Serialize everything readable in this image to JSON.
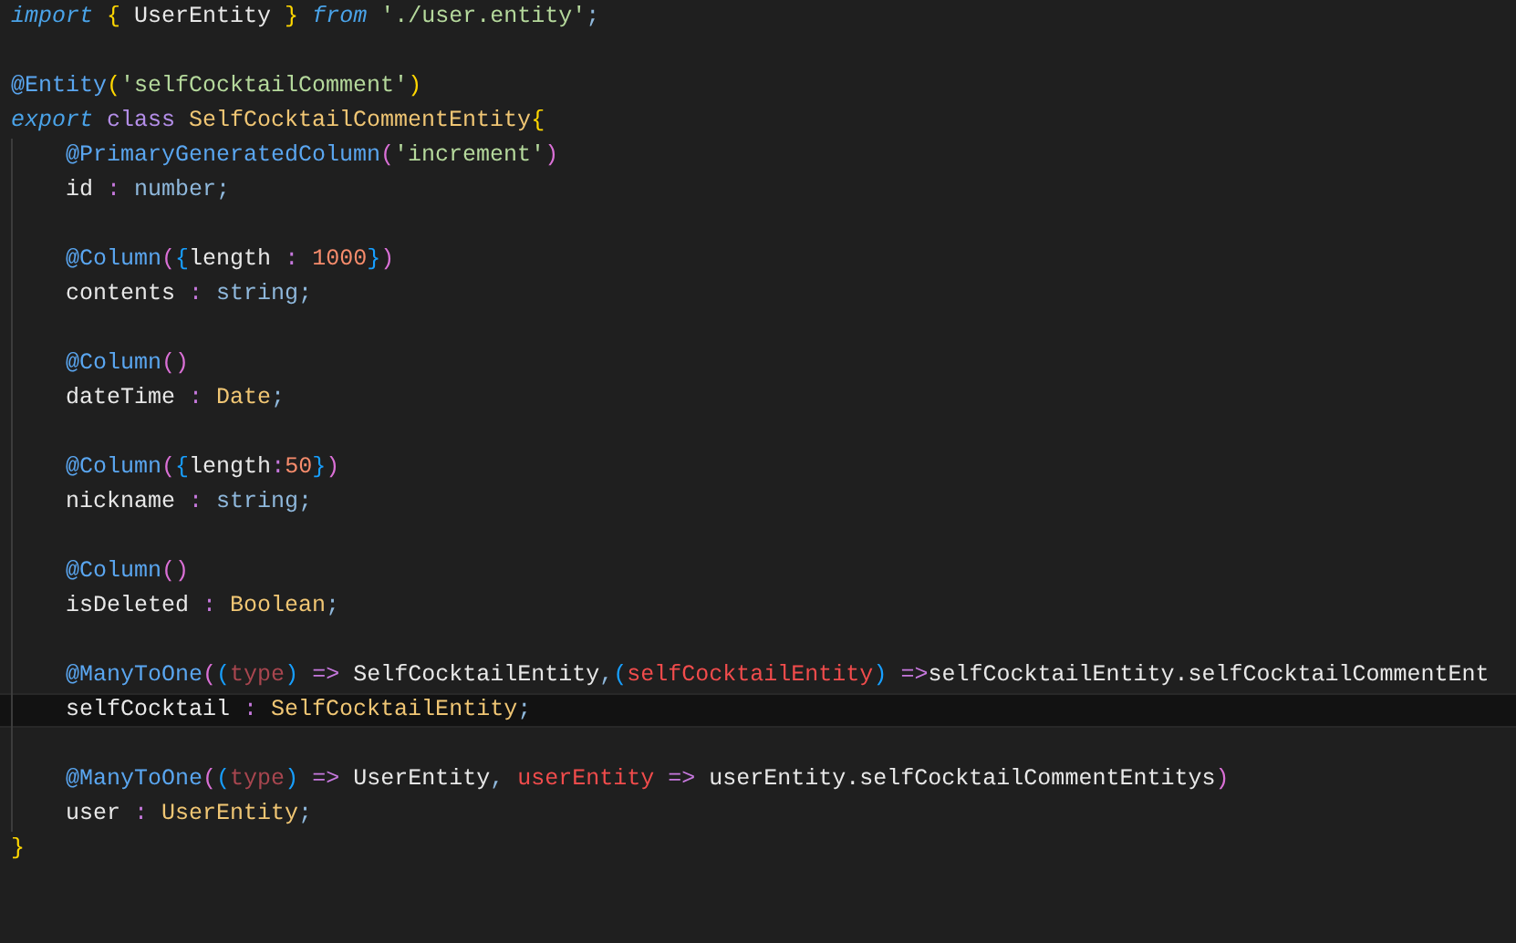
{
  "editor": {
    "lines": [
      {
        "indented": false,
        "tokens": [
          {
            "kind": "kw",
            "text": "import "
          },
          {
            "kind": "brace",
            "text": "{"
          },
          {
            "kind": "plain",
            "text": " UserEntity "
          },
          {
            "kind": "brace",
            "text": "}"
          },
          {
            "kind": "kw",
            "text": " from "
          },
          {
            "kind": "str",
            "text": "'./user.entity'"
          },
          {
            "kind": "punc",
            "text": ";"
          }
        ]
      },
      {
        "indented": false
      },
      {
        "indented": false,
        "tokens": [
          {
            "kind": "dec",
            "text": "@Entity"
          },
          {
            "kind": "brace",
            "text": "("
          },
          {
            "kind": "str",
            "text": "'selfCocktailComment'"
          },
          {
            "kind": "brace",
            "text": ")"
          }
        ]
      },
      {
        "indented": false,
        "tokens": [
          {
            "kind": "kw",
            "text": "export "
          },
          {
            "kind": "storage",
            "text": "class "
          },
          {
            "kind": "type",
            "text": "SelfCocktailCommentEntity"
          },
          {
            "kind": "brace",
            "text": "{"
          }
        ]
      },
      {
        "indented": true,
        "tokens": [
          {
            "kind": "dec",
            "text": "@PrimaryGeneratedColumn"
          },
          {
            "kind": "paren",
            "text": "("
          },
          {
            "kind": "str",
            "text": "'increment'"
          },
          {
            "kind": "paren",
            "text": ")"
          }
        ]
      },
      {
        "indented": true,
        "tokens": [
          {
            "kind": "plain",
            "text": "id "
          },
          {
            "kind": "op",
            "text": ": "
          },
          {
            "kind": "prim",
            "text": "number"
          },
          {
            "kind": "punc",
            "text": ";"
          }
        ]
      },
      {
        "indented": true
      },
      {
        "indented": true,
        "tokens": [
          {
            "kind": "dec",
            "text": "@Column"
          },
          {
            "kind": "paren",
            "text": "("
          },
          {
            "kind": "bracket",
            "text": "{"
          },
          {
            "kind": "plain",
            "text": "length "
          },
          {
            "kind": "op",
            "text": ": "
          },
          {
            "kind": "num",
            "text": "1000"
          },
          {
            "kind": "bracket",
            "text": "}"
          },
          {
            "kind": "paren",
            "text": ")"
          }
        ]
      },
      {
        "indented": true,
        "tokens": [
          {
            "kind": "plain",
            "text": "contents "
          },
          {
            "kind": "op",
            "text": ": "
          },
          {
            "kind": "prim",
            "text": "string"
          },
          {
            "kind": "punc",
            "text": ";"
          }
        ]
      },
      {
        "indented": true
      },
      {
        "indented": true,
        "tokens": [
          {
            "kind": "dec",
            "text": "@Column"
          },
          {
            "kind": "paren",
            "text": "()"
          }
        ]
      },
      {
        "indented": true,
        "tokens": [
          {
            "kind": "plain",
            "text": "dateTime "
          },
          {
            "kind": "op",
            "text": ": "
          },
          {
            "kind": "type",
            "text": "Date"
          },
          {
            "kind": "punc",
            "text": ";"
          }
        ]
      },
      {
        "indented": true
      },
      {
        "indented": true,
        "tokens": [
          {
            "kind": "dec",
            "text": "@Column"
          },
          {
            "kind": "paren",
            "text": "("
          },
          {
            "kind": "bracket",
            "text": "{"
          },
          {
            "kind": "plain",
            "text": "length"
          },
          {
            "kind": "op",
            "text": ":"
          },
          {
            "kind": "num",
            "text": "50"
          },
          {
            "kind": "bracket",
            "text": "}"
          },
          {
            "kind": "paren",
            "text": ")"
          }
        ]
      },
      {
        "indented": true,
        "tokens": [
          {
            "kind": "plain",
            "text": "nickname "
          },
          {
            "kind": "op",
            "text": ": "
          },
          {
            "kind": "prim",
            "text": "string"
          },
          {
            "kind": "punc",
            "text": ";"
          }
        ]
      },
      {
        "indented": true
      },
      {
        "indented": true,
        "tokens": [
          {
            "kind": "dec",
            "text": "@Column"
          },
          {
            "kind": "paren",
            "text": "()"
          }
        ]
      },
      {
        "indented": true,
        "tokens": [
          {
            "kind": "plain",
            "text": "isDeleted "
          },
          {
            "kind": "op",
            "text": ": "
          },
          {
            "kind": "type",
            "text": "Boolean"
          },
          {
            "kind": "punc",
            "text": ";"
          }
        ]
      },
      {
        "indented": true
      },
      {
        "indented": true,
        "tokens": [
          {
            "kind": "dec",
            "text": "@ManyToOne"
          },
          {
            "kind": "paren",
            "text": "("
          },
          {
            "kind": "bracket",
            "text": "("
          },
          {
            "kind": "param",
            "text": "type"
          },
          {
            "kind": "bracket",
            "text": ")"
          },
          {
            "kind": "op",
            "text": " => "
          },
          {
            "kind": "plain",
            "text": "SelfCocktailEntity"
          },
          {
            "kind": "punc",
            "text": ","
          },
          {
            "kind": "bracket",
            "text": "("
          },
          {
            "kind": "var",
            "text": "selfCocktailEntity"
          },
          {
            "kind": "bracket",
            "text": ")"
          },
          {
            "kind": "op",
            "text": " =>"
          },
          {
            "kind": "plain",
            "text": "selfCocktailEntity.selfCocktailCommentEnt"
          }
        ]
      },
      {
        "indented": true,
        "current": true,
        "tokens": [
          {
            "kind": "plain",
            "text": "selfCocktail "
          },
          {
            "kind": "op",
            "text": ": "
          },
          {
            "kind": "type",
            "text": "SelfCocktailEntity"
          },
          {
            "kind": "punc",
            "text": ";"
          }
        ]
      },
      {
        "indented": true
      },
      {
        "indented": true,
        "tokens": [
          {
            "kind": "dec",
            "text": "@ManyToOne"
          },
          {
            "kind": "paren",
            "text": "("
          },
          {
            "kind": "bracket",
            "text": "("
          },
          {
            "kind": "param",
            "text": "type"
          },
          {
            "kind": "bracket",
            "text": ")"
          },
          {
            "kind": "op",
            "text": " => "
          },
          {
            "kind": "plain",
            "text": "UserEntity"
          },
          {
            "kind": "punc",
            "text": ", "
          },
          {
            "kind": "var",
            "text": "userEntity"
          },
          {
            "kind": "op",
            "text": " => "
          },
          {
            "kind": "plain",
            "text": "userEntity.selfCocktailCommentEntitys"
          },
          {
            "kind": "paren",
            "text": ")"
          }
        ]
      },
      {
        "indented": true,
        "tokens": [
          {
            "kind": "plain",
            "text": "user "
          },
          {
            "kind": "op",
            "text": ": "
          },
          {
            "kind": "type",
            "text": "UserEntity"
          },
          {
            "kind": "punc",
            "text": ";"
          }
        ]
      },
      {
        "indented": false,
        "tokens": [
          {
            "kind": "brace",
            "text": "}"
          }
        ]
      }
    ]
  }
}
